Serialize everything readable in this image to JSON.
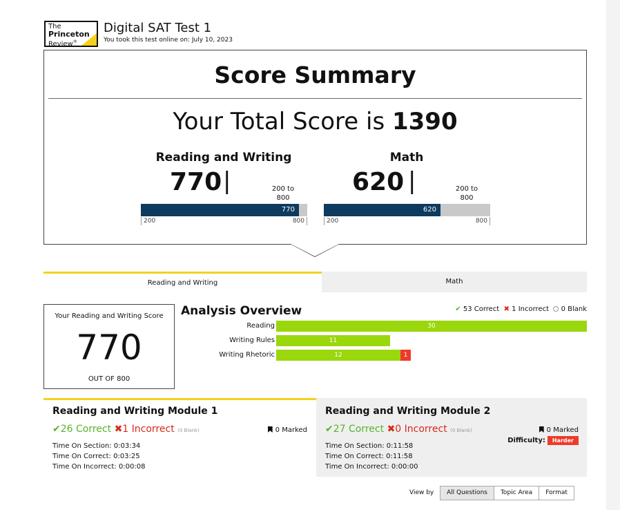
{
  "header": {
    "logo_line1": "The",
    "logo_line2": "Princeton",
    "logo_line3": "Review",
    "logo_mark": "®",
    "test_title": "Digital SAT Test 1",
    "test_date": "You took this test online on: July 10, 2023"
  },
  "summary": {
    "title": "Score Summary",
    "total_prefix": "Your Total Score is",
    "total_score": "1390",
    "sections": [
      {
        "name": "Reading and Writing",
        "score": "770",
        "range_line1": "200 to",
        "range_line2": "800",
        "bar_label": "770",
        "axis_min": "200",
        "axis_max": "800",
        "value": 770,
        "min": 200,
        "max": 800
      },
      {
        "name": "Math",
        "score": "620",
        "range_line1": "200 to",
        "range_line2": "800",
        "bar_label": "620",
        "axis_min": "200",
        "axis_max": "800",
        "value": 620,
        "min": 200,
        "max": 800
      }
    ]
  },
  "tabs": [
    {
      "label": "Reading and Writing",
      "active": true
    },
    {
      "label": "Math",
      "active": false
    }
  ],
  "score_box": {
    "label": "Your Reading and Writing Score",
    "value": "770",
    "out_of": "OUT OF 800"
  },
  "analysis": {
    "title": "Analysis Overview",
    "legend": {
      "correct": "53 Correct",
      "incorrect": "1 Incorrect",
      "blank": "0 Blank"
    },
    "rows": [
      {
        "label": "Reading",
        "correct": 30,
        "incorrect": 0,
        "correct_label": "30",
        "incorrect_label": ""
      },
      {
        "label": "Writing Rules",
        "correct": 11,
        "incorrect": 0,
        "correct_label": "11",
        "incorrect_label": ""
      },
      {
        "label": "Writing Rhetoric",
        "correct": 12,
        "incorrect": 1,
        "correct_label": "12",
        "incorrect_label": "1"
      }
    ]
  },
  "modules": [
    {
      "title": "Reading and Writing Module 1",
      "correct": "26 Correct",
      "incorrect": "1 Incorrect",
      "blank": "(0 Blank)",
      "marked": "0 Marked",
      "time_section": "Time On Section: 0:03:34",
      "time_correct": "Time On Correct: 0:03:25",
      "time_incorrect": "Time On Incorrect: 0:00:08"
    },
    {
      "title": "Reading and Writing Module 2",
      "correct": "27 Correct",
      "incorrect": "0 Incorrect",
      "blank": "(0 Blank)",
      "marked": "0 Marked",
      "difficulty_label": "Difficulty:",
      "difficulty_value": "Harder",
      "time_section": "Time On Section: 0:11:58",
      "time_correct": "Time On Correct: 0:11:58",
      "time_incorrect": "Time On Incorrect: 0:00:00"
    }
  ],
  "view_by": {
    "label": "View by",
    "options": [
      "All Questions",
      "Topic Area",
      "Format"
    ],
    "selected": "All Questions"
  },
  "colors": {
    "accent_yellow": "#f4d11c",
    "score_bar_navy": "#0e3a5e",
    "correct_green": "#9ad70c",
    "incorrect_red": "#ef3a28"
  },
  "icons": {
    "correct": "check-icon",
    "incorrect": "x-icon",
    "blank": "circle-icon",
    "marked": "bookmark-icon"
  }
}
